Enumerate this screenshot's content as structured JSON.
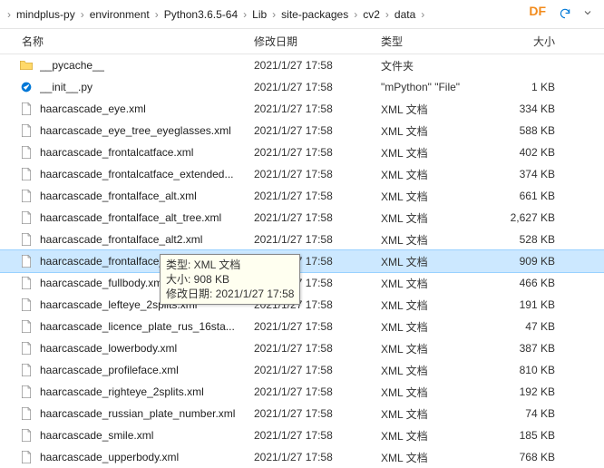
{
  "breadcrumb": {
    "items": [
      "mindplus-py",
      "environment",
      "Python3.6.5-64",
      "Lib",
      "site-packages",
      "cv2",
      "data"
    ],
    "leading_sep": "›",
    "sep": "›",
    "badge": "DF"
  },
  "headers": {
    "name": "名称",
    "date": "修改日期",
    "type": "类型",
    "size": "大小"
  },
  "tooltip": {
    "line1": "类型: XML 文档",
    "line2": "大小: 908 KB",
    "line3": "修改日期: 2021/1/27 17:58"
  },
  "files": [
    {
      "icon": "folder",
      "name": "__pycache__",
      "date": "2021/1/27 17:58",
      "type": "文件夹",
      "size": ""
    },
    {
      "icon": "py",
      "name": "__init__.py",
      "date": "2021/1/27 17:58",
      "type": "\"mPython\" \"File\"",
      "size": "1 KB"
    },
    {
      "icon": "file",
      "name": "haarcascade_eye.xml",
      "date": "2021/1/27 17:58",
      "type": "XML 文档",
      "size": "334 KB"
    },
    {
      "icon": "file",
      "name": "haarcascade_eye_tree_eyeglasses.xml",
      "date": "2021/1/27 17:58",
      "type": "XML 文档",
      "size": "588 KB"
    },
    {
      "icon": "file",
      "name": "haarcascade_frontalcatface.xml",
      "date": "2021/1/27 17:58",
      "type": "XML 文档",
      "size": "402 KB"
    },
    {
      "icon": "file",
      "name": "haarcascade_frontalcatface_extended...",
      "date": "2021/1/27 17:58",
      "type": "XML 文档",
      "size": "374 KB"
    },
    {
      "icon": "file",
      "name": "haarcascade_frontalface_alt.xml",
      "date": "2021/1/27 17:58",
      "type": "XML 文档",
      "size": "661 KB"
    },
    {
      "icon": "file",
      "name": "haarcascade_frontalface_alt_tree.xml",
      "date": "2021/1/27 17:58",
      "type": "XML 文档",
      "size": "2,627 KB"
    },
    {
      "icon": "file",
      "name": "haarcascade_frontalface_alt2.xml",
      "date": "2021/1/27 17:58",
      "type": "XML 文档",
      "size": "528 KB"
    },
    {
      "icon": "file",
      "name": "haarcascade_frontalface_default.xml",
      "date": "2021/1/27 17:58",
      "type": "XML 文档",
      "size": "909 KB",
      "selected": true
    },
    {
      "icon": "file",
      "name": "haarcascade_fullbody.xml",
      "date": "2021/1/27 17:58",
      "type": "XML 文档",
      "size": "466 KB"
    },
    {
      "icon": "file",
      "name": "haarcascade_lefteye_2splits.xml",
      "date": "2021/1/27 17:58",
      "type": "XML 文档",
      "size": "191 KB"
    },
    {
      "icon": "file",
      "name": "haarcascade_licence_plate_rus_16sta...",
      "date": "2021/1/27 17:58",
      "type": "XML 文档",
      "size": "47 KB"
    },
    {
      "icon": "file",
      "name": "haarcascade_lowerbody.xml",
      "date": "2021/1/27 17:58",
      "type": "XML 文档",
      "size": "387 KB"
    },
    {
      "icon": "file",
      "name": "haarcascade_profileface.xml",
      "date": "2021/1/27 17:58",
      "type": "XML 文档",
      "size": "810 KB"
    },
    {
      "icon": "file",
      "name": "haarcascade_righteye_2splits.xml",
      "date": "2021/1/27 17:58",
      "type": "XML 文档",
      "size": "192 KB"
    },
    {
      "icon": "file",
      "name": "haarcascade_russian_plate_number.xml",
      "date": "2021/1/27 17:58",
      "type": "XML 文档",
      "size": "74 KB"
    },
    {
      "icon": "file",
      "name": "haarcascade_smile.xml",
      "date": "2021/1/27 17:58",
      "type": "XML 文档",
      "size": "185 KB"
    },
    {
      "icon": "file",
      "name": "haarcascade_upperbody.xml",
      "date": "2021/1/27 17:58",
      "type": "XML 文档",
      "size": "768 KB"
    }
  ]
}
